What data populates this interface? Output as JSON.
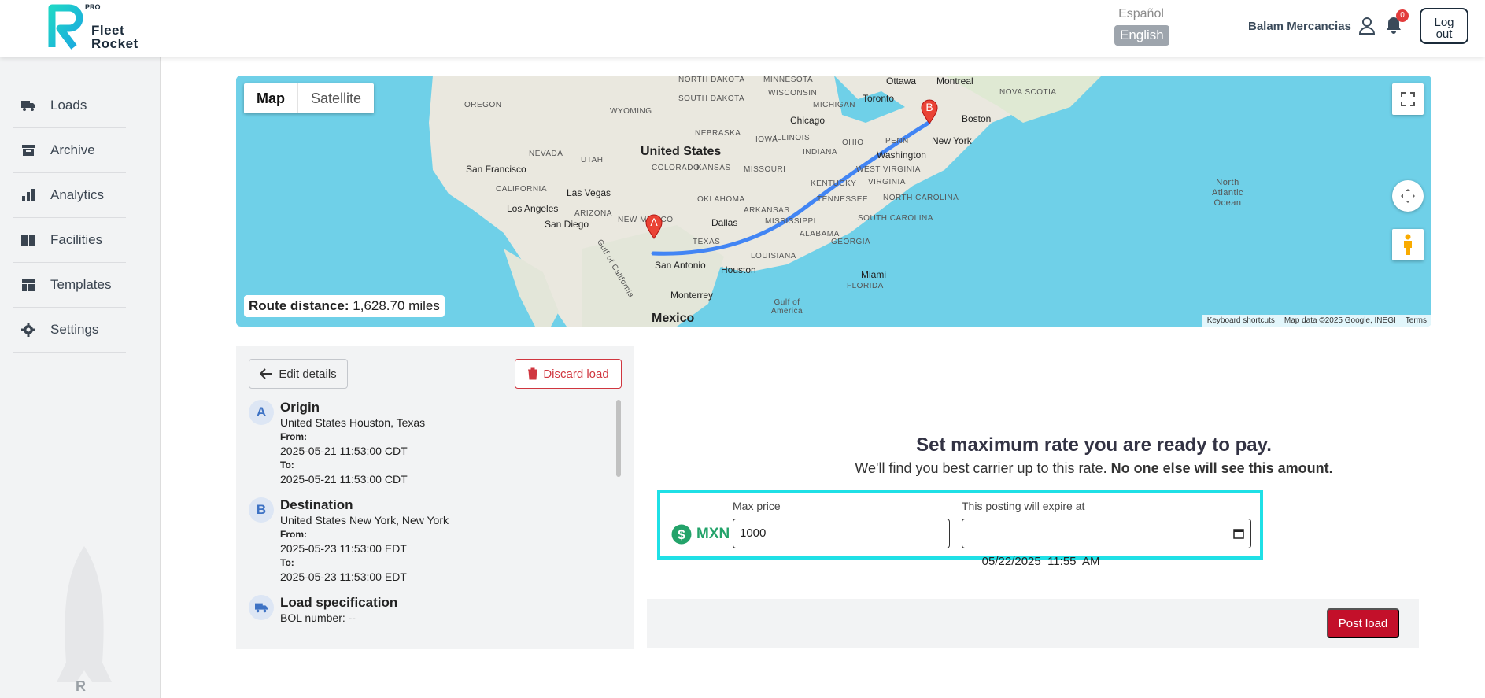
{
  "header": {
    "brand_line1": "Fleet",
    "brand_line2": "Rocket",
    "pro": "PRO",
    "lang_es": "Español",
    "lang_en": "English",
    "user_name": "Balam Mercancias",
    "notif_count": "0",
    "logout_line1": "Log",
    "logout_line2": "out"
  },
  "sidebar": {
    "items": [
      {
        "label": "Loads",
        "icon": "truck-icon"
      },
      {
        "label": "Archive",
        "icon": "archive-icon"
      },
      {
        "label": "Analytics",
        "icon": "bar-chart-icon"
      },
      {
        "label": "Facilities",
        "icon": "book-icon"
      },
      {
        "label": "Templates",
        "icon": "template-icon"
      },
      {
        "label": "Settings",
        "icon": "gear-icon"
      }
    ]
  },
  "map": {
    "type_map": "Map",
    "type_satellite": "Satellite",
    "route_label": "Route distance:",
    "route_value": "1,628.70 miles",
    "footer_shortcuts": "Keyboard shortcuts",
    "footer_data": "Map data ©2025 Google, INEGI",
    "footer_terms": "Terms",
    "marker_a": "A",
    "marker_b": "B",
    "labels": {
      "us": "United States",
      "mexico": "Mexico",
      "north_atlantic": "North Atlantic Ocean",
      "gulf": "Gulf of America",
      "gulf_cal": "Gulf of California",
      "cities": [
        "San Francisco",
        "Las Vegas",
        "Los Angeles",
        "San Diego",
        "Dallas",
        "Houston",
        "San Antonio",
        "Monterrey",
        "Chicago",
        "Toronto",
        "Washington",
        "New York",
        "Boston",
        "Miami",
        "Ottawa",
        "Montreal"
      ],
      "states": [
        "OREGON",
        "NEVADA",
        "UTAH",
        "ARIZONA",
        "CALIFORNIA",
        "NEW MEXICO",
        "TEXAS",
        "OKLAHOMA",
        "KANSAS",
        "NEBRASKA",
        "COLORADO",
        "WYOMING",
        "SOUTH DAKOTA",
        "NORTH DAKOTA",
        "MINNESOTA",
        "WISCONSIN",
        "MICHIGAN",
        "IOWA",
        "ILLINOIS",
        "INDIANA",
        "OHIO",
        "MISSOURI",
        "ARKANSAS",
        "LOUISIANA",
        "MISSISSIPPI",
        "ALABAMA",
        "GEORGIA",
        "FLORIDA",
        "TENNESSEE",
        "KENTUCKY",
        "WEST VIRGINIA",
        "VIRGINIA",
        "NORTH CAROLINA",
        "SOUTH CAROLINA",
        "PENN",
        "NOVA SCOTIA"
      ]
    }
  },
  "details": {
    "edit_label": "Edit details",
    "discard_label": "Discard load",
    "origin": {
      "letter": "A",
      "title": "Origin",
      "location": "United States Houston, Texas",
      "from_label": "From:",
      "from": "2025-05-21 11:53:00 CDT",
      "to_label": "To:",
      "to": "2025-05-21 11:53:00 CDT"
    },
    "destination": {
      "letter": "B",
      "title": "Destination",
      "location": "United States New York, New York",
      "from_label": "From:",
      "from": "2025-05-23 11:53:00 EDT",
      "to_label": "To:",
      "to": "2025-05-23 11:53:00 EDT"
    },
    "spec": {
      "title": "Load specification",
      "bol": "BOL number: --"
    }
  },
  "rate": {
    "title": "Set maximum rate you are ready to pay.",
    "subtitle": "We'll find you best carrier up to this rate.",
    "subtitle_bold": "No one else will see this amount.",
    "currency": "MXN",
    "max_price_label": "Max price",
    "max_price_value": "1000",
    "expire_label": "This posting will expire at",
    "expire_value": "05/22/2025  11:55  AM",
    "post_label": "Post load"
  },
  "colors": {
    "accent": "#1fe0e6",
    "danger": "#c3102a",
    "currency_green": "#23a36a",
    "map_water": "#6fd0e8"
  }
}
